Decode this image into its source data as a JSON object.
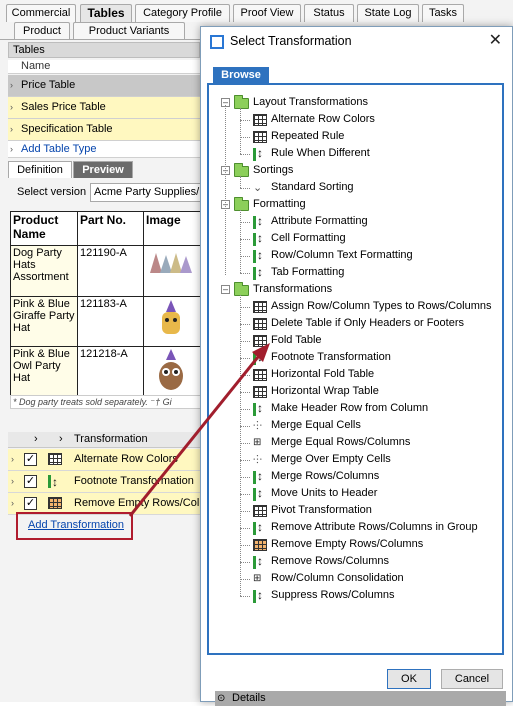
{
  "main_tabs": [
    "Commercial",
    "Tables",
    "Category Profile",
    "Proof View",
    "Status",
    "State Log",
    "Tasks"
  ],
  "sub_tabs": [
    "Product",
    "Product Variants"
  ],
  "tables_panel": {
    "header": "Tables",
    "column_name": "Name",
    "rows": [
      "Price Table",
      "Sales Price Table",
      "Specification Table"
    ],
    "add_link": "Add Table Type"
  },
  "def_tabs": [
    "Definition",
    "Preview"
  ],
  "version": {
    "label": "Select version",
    "value": "Acme Party Supplies/E"
  },
  "product_table": {
    "headers": [
      "Product Name",
      "Part No.",
      "Image"
    ],
    "rows": [
      {
        "name": "Dog Party Hats Assortment",
        "part": "121190-A"
      },
      {
        "name": "Pink & Blue Giraffe Party Hat",
        "part": "121183-A"
      },
      {
        "name": "Pink & Blue Owl Party Hat",
        "part": "121218-A"
      }
    ],
    "footnote": "* Dog party treats sold separately. ⁻† Gi"
  },
  "transformations_panel": {
    "header": "Transformation",
    "rows": [
      "Alternate Row Colors",
      "Footnote Transformation",
      "Remove Empty Rows/Colu"
    ],
    "add_link": "Add Transformation"
  },
  "dialog": {
    "title": "Select Transformation",
    "close": "✕",
    "browse_tab": "Browse",
    "tree": [
      {
        "folder": "Layout Transformations",
        "items": [
          {
            "label": "Alternate Row Colors",
            "icon": "grid-icon"
          },
          {
            "label": "Repeated Rule",
            "icon": "grid-icon"
          },
          {
            "label": "Rule When Different",
            "icon": "bar-icon"
          }
        ]
      },
      {
        "folder": "Sortings",
        "items": [
          {
            "label": "Standard Sorting",
            "icon": "sort-chevron-icon"
          }
        ]
      },
      {
        "folder": "Formatting",
        "items": [
          {
            "label": "Attribute Formatting",
            "icon": "bar-icon"
          },
          {
            "label": "Cell Formatting",
            "icon": "bar-icon"
          },
          {
            "label": "Row/Column Text Formatting",
            "icon": "bar-icon"
          },
          {
            "label": "Tab Formatting",
            "icon": "bar-icon"
          }
        ]
      },
      {
        "folder": "Transformations",
        "items": [
          {
            "label": "Assign Row/Column Types to Rows/Columns",
            "icon": "grid-icon"
          },
          {
            "label": "Delete Table if Only Headers or Footers",
            "icon": "grid-icon"
          },
          {
            "label": "Fold Table",
            "icon": "grid-icon"
          },
          {
            "label": "Footnote Transformation",
            "icon": "bar-icon"
          },
          {
            "label": "Horizontal Fold Table",
            "icon": "grid-icon"
          },
          {
            "label": "Horizontal Wrap Table",
            "icon": "grid-icon"
          },
          {
            "label": "Make Header Row from Column",
            "icon": "bar-icon"
          },
          {
            "label": "Merge Equal Cells",
            "icon": "brush-icon"
          },
          {
            "label": "Merge Equal Rows/Columns",
            "icon": "merge-icon"
          },
          {
            "label": "Merge Over Empty Cells",
            "icon": "brush-icon"
          },
          {
            "label": "Merge Rows/Columns",
            "icon": "bar-icon"
          },
          {
            "label": "Move Units to Header",
            "icon": "bar-icon"
          },
          {
            "label": "Pivot Transformation",
            "icon": "grid-icon"
          },
          {
            "label": "Remove Attribute Rows/Columns in Group",
            "icon": "bar-icon"
          },
          {
            "label": "Remove Empty Rows/Columns",
            "icon": "grid-orange-icon"
          },
          {
            "label": "Remove Rows/Columns",
            "icon": "bar-icon"
          },
          {
            "label": "Row/Column Consolidation",
            "icon": "merge-icon"
          },
          {
            "label": "Suppress Rows/Columns",
            "icon": "bar-icon"
          }
        ]
      }
    ],
    "details_label": "Details",
    "ok_label": "OK",
    "cancel_label": "Cancel"
  },
  "colors": {
    "accent": "#2e72bf",
    "highlight_box": "#b01c2e",
    "row_yellow": "#fff8c0"
  }
}
